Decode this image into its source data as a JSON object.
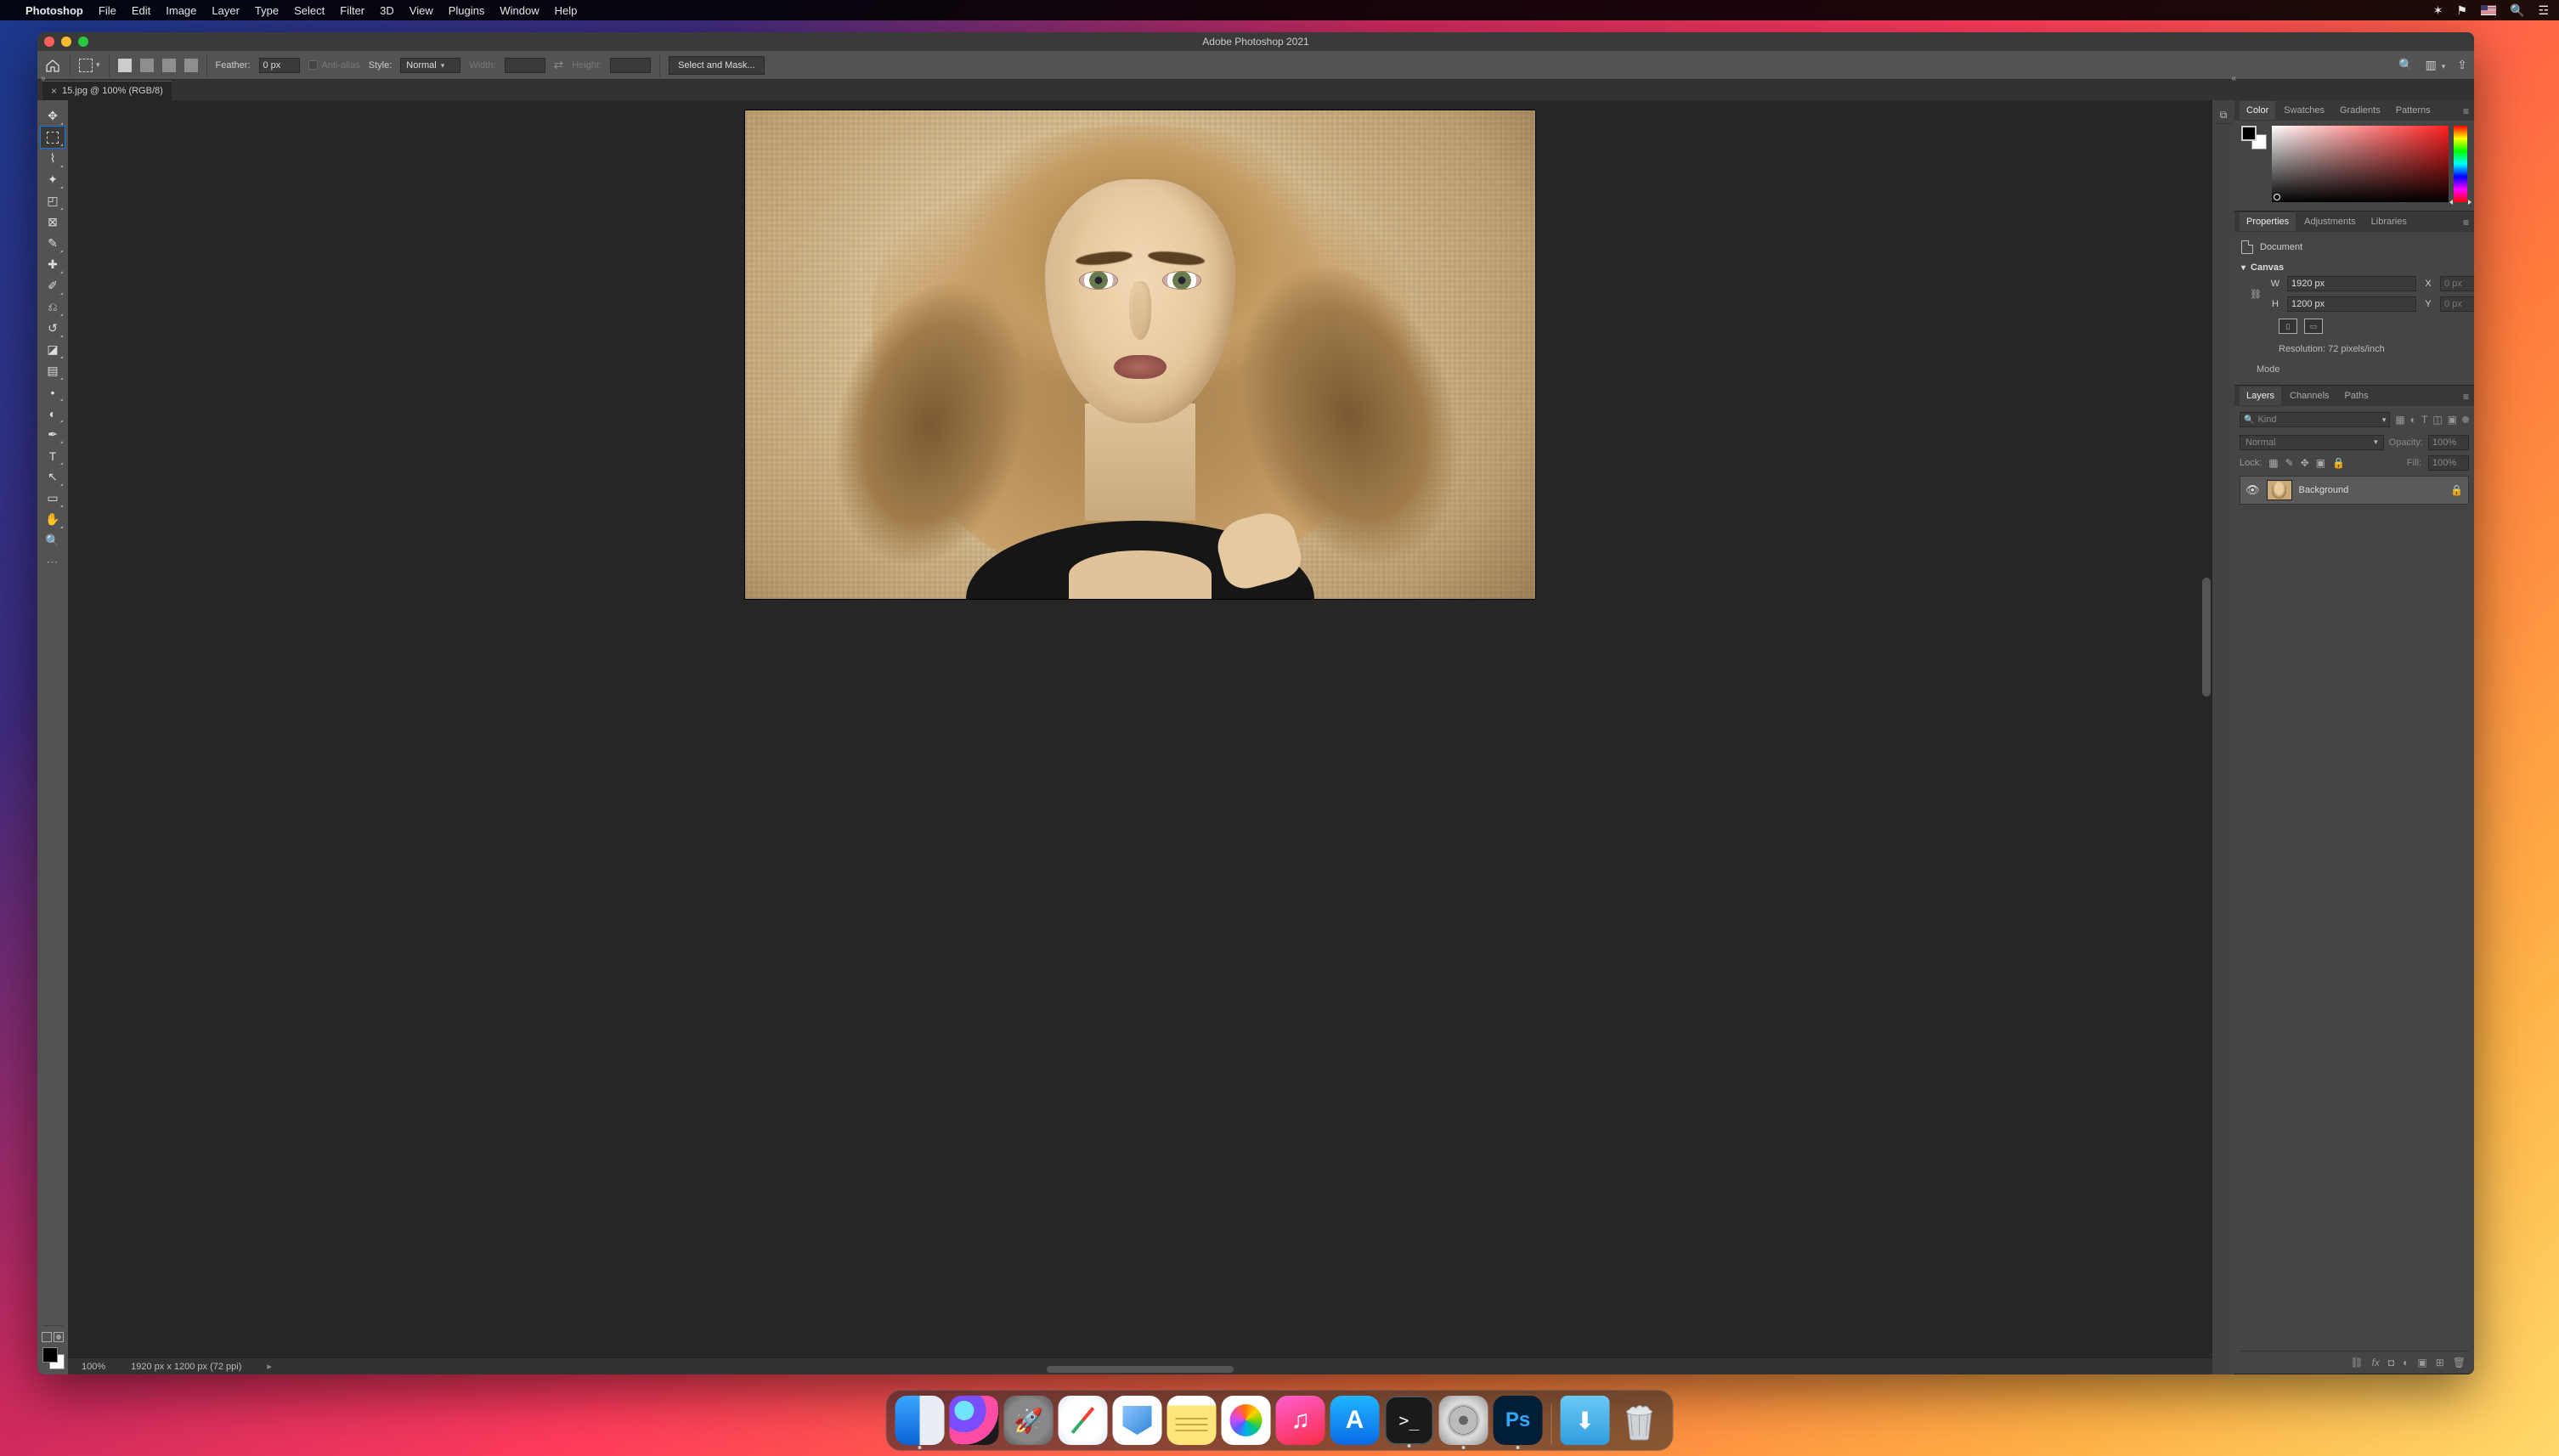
{
  "mac_menubar": {
    "app": "Photoshop",
    "items": [
      "File",
      "Edit",
      "Image",
      "Layer",
      "Type",
      "Select",
      "Filter",
      "3D",
      "View",
      "Plugins",
      "Window",
      "Help"
    ]
  },
  "window": {
    "title": "Adobe Photoshop 2021"
  },
  "optionsbar": {
    "feather_label": "Feather:",
    "feather_value": "0 px",
    "antialias_label": "Anti-alias",
    "style_label": "Style:",
    "style_value": "Normal",
    "width_label": "Width:",
    "width_value": "",
    "height_label": "Height:",
    "height_value": "",
    "select_mask": "Select and Mask..."
  },
  "document_tab": {
    "label": "15.jpg @ 100% (RGB/8)"
  },
  "status": {
    "zoom": "100%",
    "dims": "1920 px x 1200 px (72 ppi)"
  },
  "panels": {
    "color_tabs": [
      "Color",
      "Swatches",
      "Gradients",
      "Patterns"
    ],
    "props_tabs": [
      "Properties",
      "Adjustments",
      "Libraries"
    ],
    "layers_tabs": [
      "Layers",
      "Channels",
      "Paths"
    ]
  },
  "properties": {
    "doc_label": "Document",
    "canvas_label": "Canvas",
    "w_label": "W",
    "w_value": "1920 px",
    "h_label": "H",
    "h_value": "1200 px",
    "x_label": "X",
    "x_value": "0 px",
    "y_label": "Y",
    "y_value": "0 px",
    "resolution": "Resolution: 72 pixels/inch",
    "mode_label": "Mode"
  },
  "layers": {
    "kind_placeholder": "Kind",
    "blend_mode": "Normal",
    "opacity_label": "Opacity:",
    "opacity_value": "100%",
    "lock_label": "Lock:",
    "fill_label": "Fill:",
    "fill_value": "100%",
    "layer_name": "Background"
  },
  "dock": {
    "items": [
      "finder",
      "siri",
      "launchpad",
      "safari",
      "mail",
      "notes",
      "photos",
      "music",
      "appstore",
      "terminal",
      "settings",
      "photoshop"
    ],
    "running": [
      "finder",
      "terminal",
      "settings",
      "photoshop"
    ],
    "downloads": "downloads",
    "trash": "trash-full"
  }
}
